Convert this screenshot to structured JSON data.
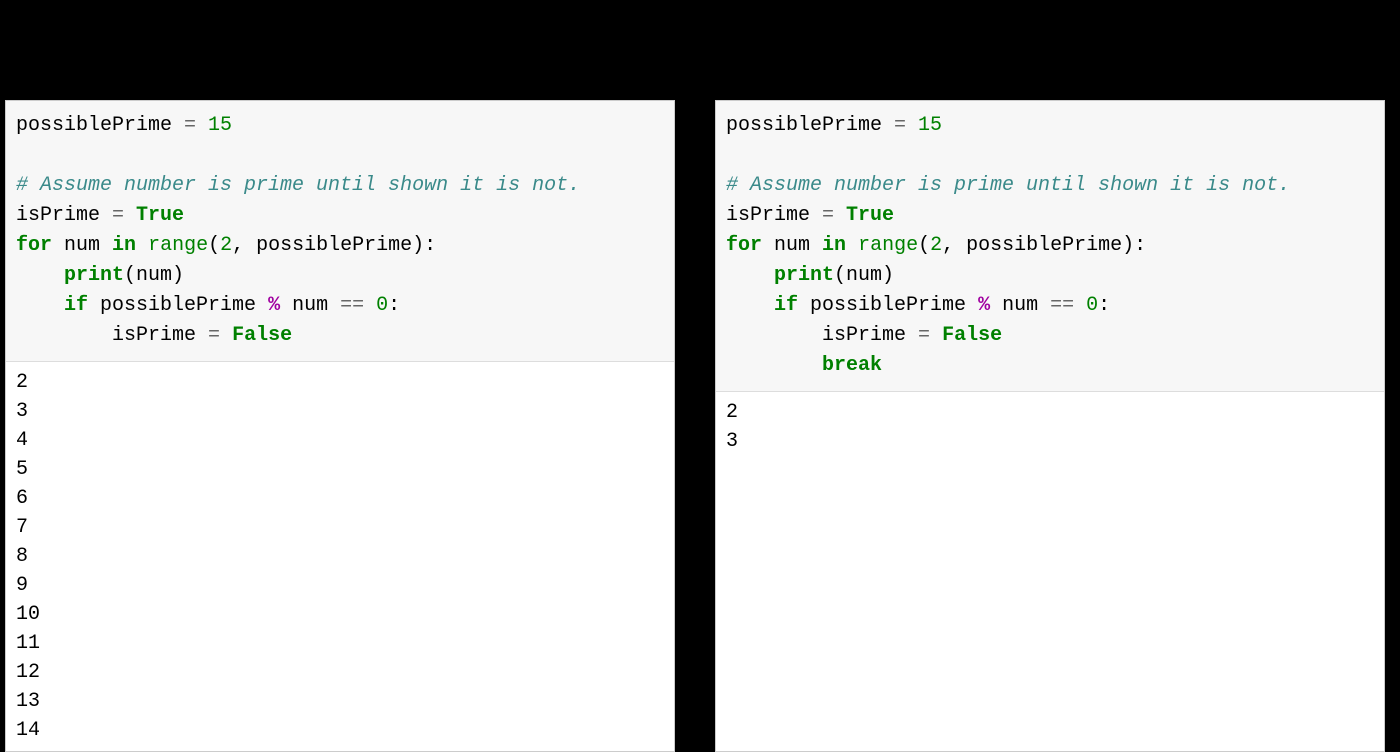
{
  "left": {
    "line1_a": "possiblePrime ",
    "line1_b": "=",
    "line1_c": " 15",
    "line2": "",
    "line3": "# Assume number is prime until shown it is not.",
    "line4_a": "isPrime ",
    "line4_b": "=",
    "line4_c": " ",
    "line4_d": "True",
    "line5_a": "for",
    "line5_b": " num ",
    "line5_c": "in",
    "line5_d": " ",
    "line5_e": "range",
    "line5_f": "(",
    "line5_g": "2",
    "line5_h": ", possiblePrime):",
    "line6_a": "    ",
    "line6_b": "print",
    "line6_c": "(num)",
    "line7_a": "    ",
    "line7_b": "if",
    "line7_c": " possiblePrime ",
    "line7_d": "%",
    "line7_e": " num ",
    "line7_f": "==",
    "line7_g": " ",
    "line7_h": "0",
    "line7_i": ":",
    "line8_a": "        isPrime ",
    "line8_b": "=",
    "line8_c": " ",
    "line8_d": "False",
    "output": "2\n3\n4\n5\n6\n7\n8\n9\n10\n11\n12\n13\n14"
  },
  "right": {
    "line1_a": "possiblePrime ",
    "line1_b": "=",
    "line1_c": " 15",
    "line2": "",
    "line3": "# Assume number is prime until shown it is not.",
    "line4_a": "isPrime ",
    "line4_b": "=",
    "line4_c": " ",
    "line4_d": "True",
    "line5_a": "for",
    "line5_b": " num ",
    "line5_c": "in",
    "line5_d": " ",
    "line5_e": "range",
    "line5_f": "(",
    "line5_g": "2",
    "line5_h": ", possiblePrime):",
    "line6_a": "    ",
    "line6_b": "print",
    "line6_c": "(num)",
    "line7_a": "    ",
    "line7_b": "if",
    "line7_c": " possiblePrime ",
    "line7_d": "%",
    "line7_e": " num ",
    "line7_f": "==",
    "line7_g": " ",
    "line7_h": "0",
    "line7_i": ":",
    "line8_a": "        isPrime ",
    "line8_b": "=",
    "line8_c": " ",
    "line8_d": "False",
    "line9_a": "        ",
    "line9_b": "break",
    "output": "2\n3"
  }
}
